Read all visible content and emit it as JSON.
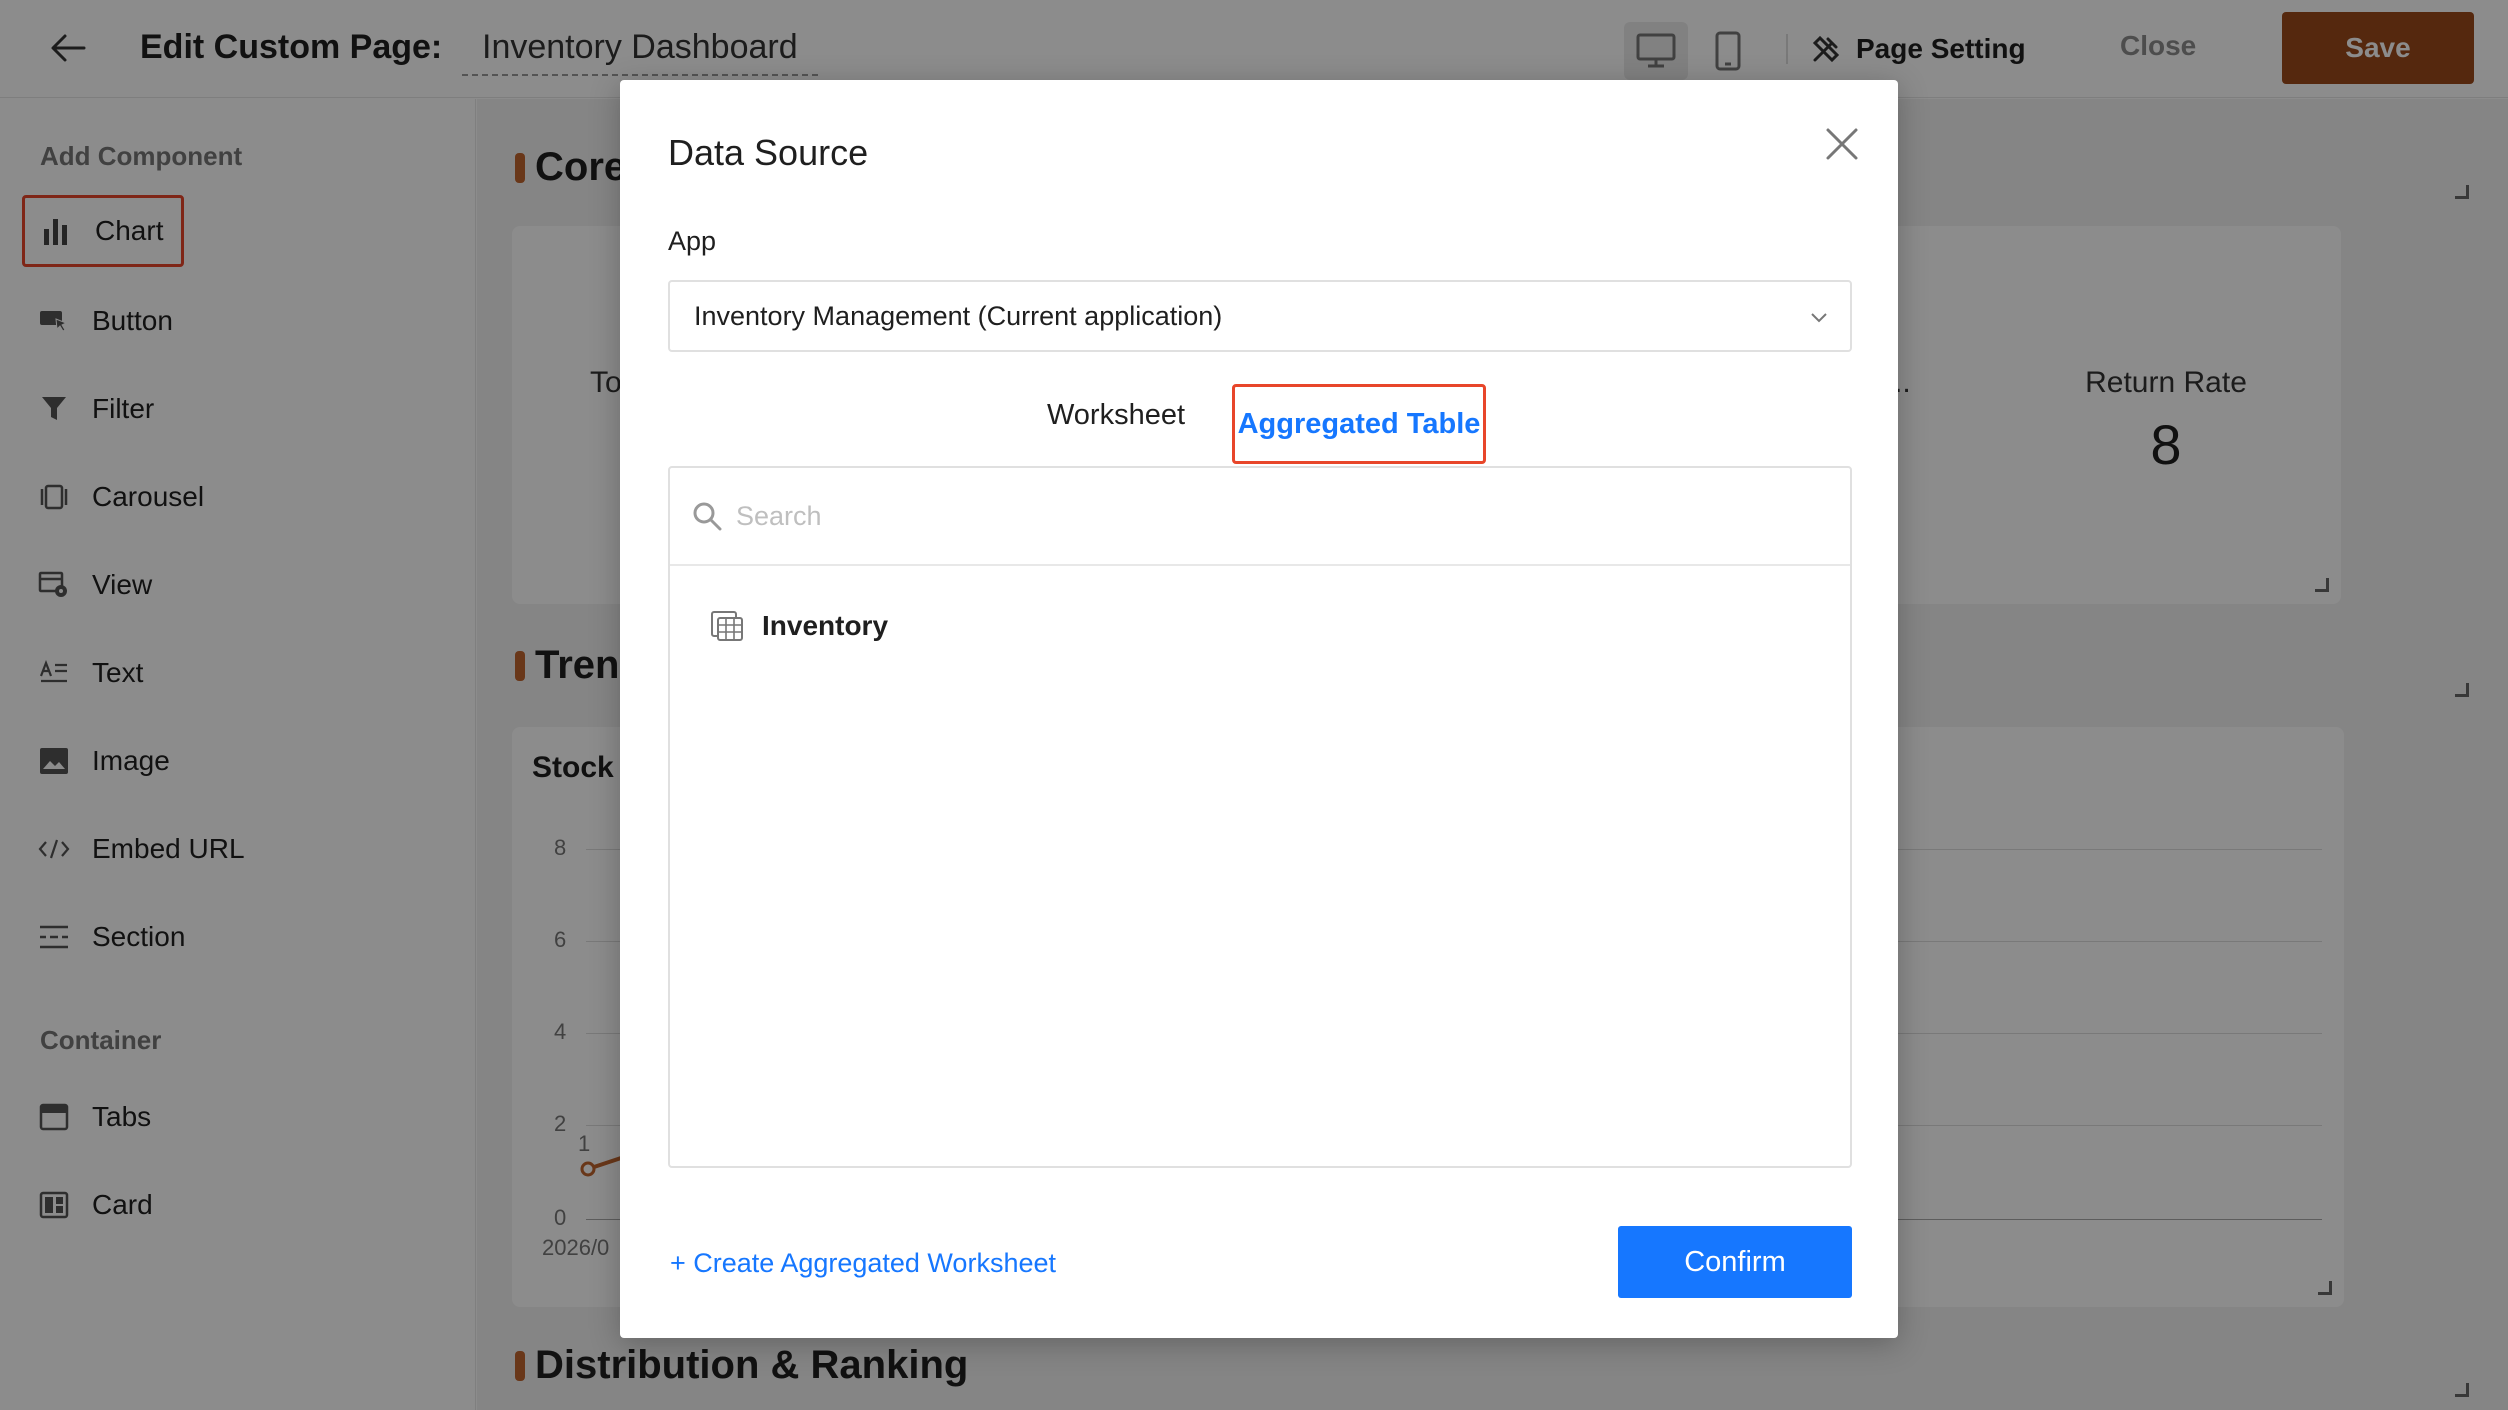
{
  "header": {
    "page_label": "Edit Custom Page:",
    "page_name": "Inventory Dashboard",
    "page_setting_label": "Page Setting",
    "close_label": "Close",
    "save_label": "Save"
  },
  "sidebar": {
    "section_add": "Add Component",
    "components": [
      {
        "label": "Chart",
        "icon": "bar-chart-icon"
      },
      {
        "label": "Button",
        "icon": "cursor-button-icon"
      },
      {
        "label": "Filter",
        "icon": "funnel-icon"
      },
      {
        "label": "Carousel",
        "icon": "carousel-icon"
      },
      {
        "label": "View",
        "icon": "view-icon"
      },
      {
        "label": "Text",
        "icon": "text-icon"
      },
      {
        "label": "Image",
        "icon": "image-icon"
      },
      {
        "label": "Embed URL",
        "icon": "code-icon"
      },
      {
        "label": "Section",
        "icon": "section-icon"
      }
    ],
    "section_container": "Container",
    "containers": [
      {
        "label": "Tabs",
        "icon": "tabs-icon"
      },
      {
        "label": "Card",
        "icon": "card-icon"
      }
    ]
  },
  "canvas": {
    "section_core": "Core",
    "section_trend": "Tren",
    "section_distribution": "Distribution & Ranking",
    "card_left_label": "To",
    "card_mid_label": "i...",
    "return_rate": {
      "label": "Return Rate",
      "value": "8"
    },
    "chart_title": "Stock",
    "y_ticks": [
      "8",
      "6",
      "4",
      "2",
      "0"
    ],
    "x_tick": "2026/0",
    "point_label": "1"
  },
  "modal": {
    "title": "Data Source",
    "app_label": "App",
    "app_value": "Inventory Management (Current application)",
    "tabs": {
      "worksheet": "Worksheet",
      "aggregated": "Aggregated Table"
    },
    "search_placeholder": "Search",
    "items": [
      {
        "label": "Inventory",
        "icon": "table-icon"
      }
    ],
    "create_link": "+ Create Aggregated Worksheet",
    "confirm_label": "Confirm"
  },
  "colors": {
    "accent": "#1677ff",
    "save": "#9c4a1a",
    "highlight": "#e8462a",
    "section_bar": "#c0642e"
  }
}
